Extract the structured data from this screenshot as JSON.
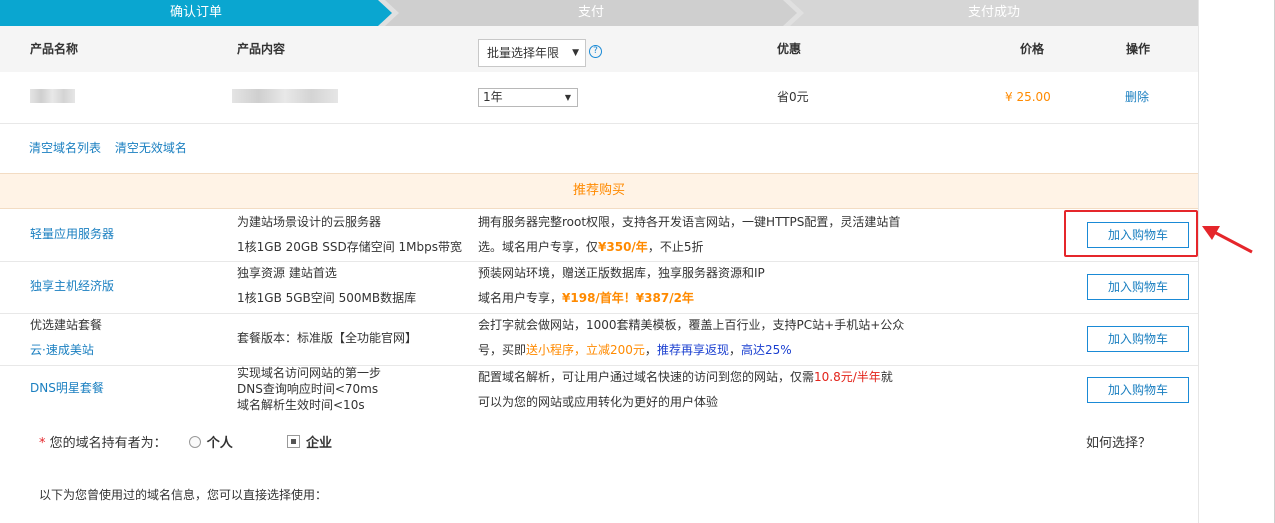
{
  "steps": [
    "确认订单",
    "支付",
    "支付成功"
  ],
  "table_header": {
    "name": "产品名称",
    "content": "产品内容",
    "batch_select": "批量选择年限",
    "discount": "优惠",
    "price": "价格",
    "action": "操作"
  },
  "product_row": {
    "year": "1年",
    "discount": "省0元",
    "price": "¥ 25.00",
    "delete": "删除"
  },
  "clear_links": [
    "清空域名列表",
    "清空无效域名"
  ],
  "recommend_title": "推荐购买",
  "cart_label": "加入购物车",
  "recommend": [
    {
      "name": "轻量应用服务器",
      "content": [
        "为建站场景设计的云服务器",
        "1核1GB 20GB SSD存储空间 1Mbps带宽"
      ],
      "desc1": "拥有服务器完整root权限，支持各开发语言网站，一键HTTPS配置，灵活建站首",
      "desc2_a": "选。域名用户专享，仅",
      "desc2_b": "¥350/年",
      "desc2_c": "，不止5折"
    },
    {
      "name": "独享主机经济版",
      "content": [
        "独享资源 建站首选",
        "1核1GB 5GB空间 500MB数据库"
      ],
      "desc1": "预装网站环境，赠送正版数据库，独享服务器资源和IP",
      "desc2_a": "域名用户专享，",
      "desc2_b": "¥198/首年！¥387/2年"
    },
    {
      "name_a": "优选建站套餐",
      "name_b": "云·速成美站",
      "content": [
        "套餐版本：标准版【全功能官网】"
      ],
      "desc1": "会打字就会做网站，1000套精美模板，覆盖上百行业，支持PC站+手机站+公众",
      "desc2_a": "号，买即",
      "desc2_b": "送小程序，立减200元",
      "desc2_c": "，",
      "desc2_d": "推荐再享返现",
      "desc2_e": "，",
      "desc2_f": "高达25%"
    },
    {
      "name": "DNS明星套餐",
      "content": [
        "实现域名访问网站的第一步",
        "DNS查询响应时间<70ms",
        "域名解析生效时间<10s"
      ],
      "desc1_a": "配置域名解析，可让用户通过域名快速的访问到您的网站，仅需",
      "desc1_b": "10.8元/半年",
      "desc1_c": "就",
      "desc2": "可以为您的网站或应用转化为更好的用户体验"
    }
  ],
  "owner": {
    "required_mark": "*",
    "label": "您的域名持有者为：",
    "option_personal": "个人",
    "option_enterprise": "企业",
    "how": "如何选择？"
  },
  "info": "以下为您曾使用过的域名信息，您可以直接选择使用："
}
